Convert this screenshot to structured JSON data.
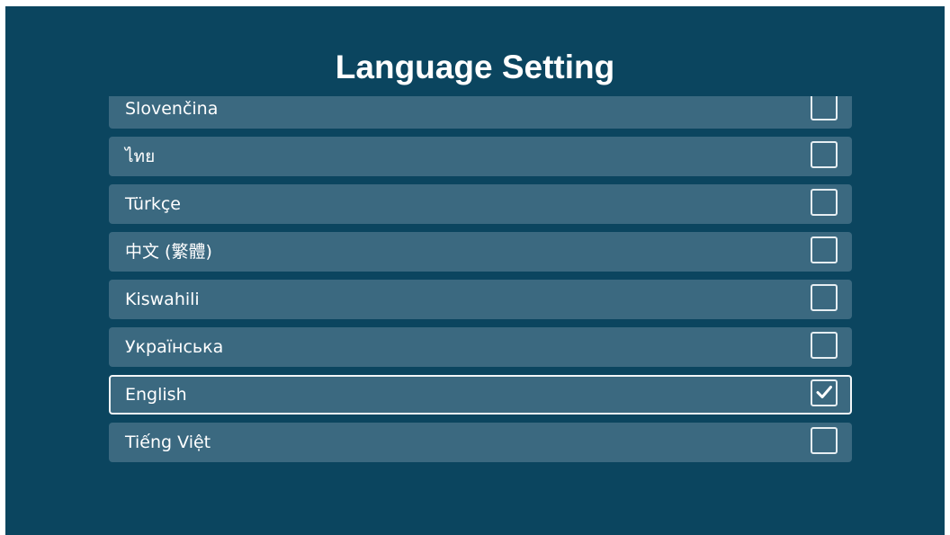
{
  "page": {
    "title": "Language Setting"
  },
  "languages": [
    {
      "label": "Slovenčina",
      "checked": false
    },
    {
      "label": "ไทย",
      "checked": false
    },
    {
      "label": "Türkçe",
      "checked": false
    },
    {
      "label": "中文 (繁體)",
      "checked": false
    },
    {
      "label": "Kiswahili",
      "checked": false
    },
    {
      "label": "Українська",
      "checked": false
    },
    {
      "label": "English",
      "checked": true
    },
    {
      "label": "Tiếng Việt",
      "checked": false
    }
  ],
  "colors": {
    "background": "#0b455f",
    "row": "#3b6980",
    "text": "#ffffff",
    "focus_border": "#f2f6f8"
  }
}
